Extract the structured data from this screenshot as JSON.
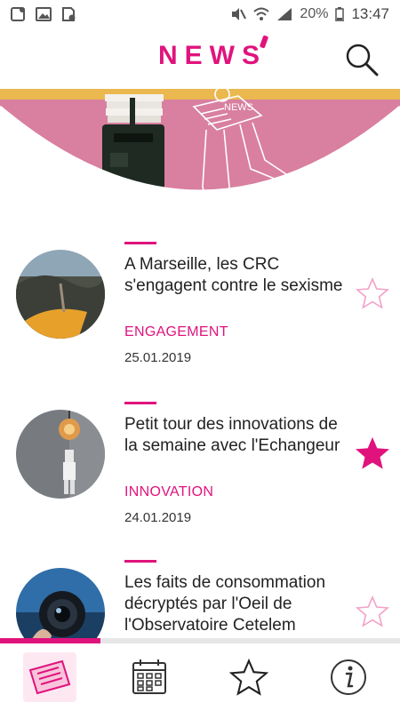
{
  "status_bar": {
    "icons_left": [
      "notification-icon",
      "gallery-icon",
      "storage-icon"
    ],
    "icons_right": [
      "mute-icon",
      "wifi-icon",
      "signal-icon"
    ],
    "battery": "20%",
    "time": "13:47"
  },
  "header": {
    "logo": "NEWS",
    "search_icon": "search-icon"
  },
  "hero": {
    "sign_text": "NEWS",
    "colors": {
      "wall": "#d97fa0",
      "sky": "#eab84f",
      "mailbox": "#1e2a22"
    }
  },
  "articles": [
    {
      "title": "A Marseille, les CRC s'engagent contre le sexisme",
      "category": "ENGAGEMENT",
      "date": "25.01.2019",
      "favorite": false
    },
    {
      "title": "Petit tour des innovations de la semaine avec l'Echangeur",
      "category": "INNOVATION",
      "date": "24.01.2019",
      "favorite": true
    },
    {
      "title": "Les faits de consommation décryptés par l'Oeil de l'Observatoire Cetelem",
      "category": "",
      "date": "",
      "favorite": false
    }
  ],
  "scroll_progress": 0.25,
  "bottom_nav": [
    {
      "icon": "newspaper-icon",
      "active": true
    },
    {
      "icon": "calendar-icon",
      "active": false
    },
    {
      "icon": "star-icon",
      "active": false
    },
    {
      "icon": "info-icon",
      "active": false
    }
  ],
  "colors": {
    "accent": "#e0137d"
  }
}
